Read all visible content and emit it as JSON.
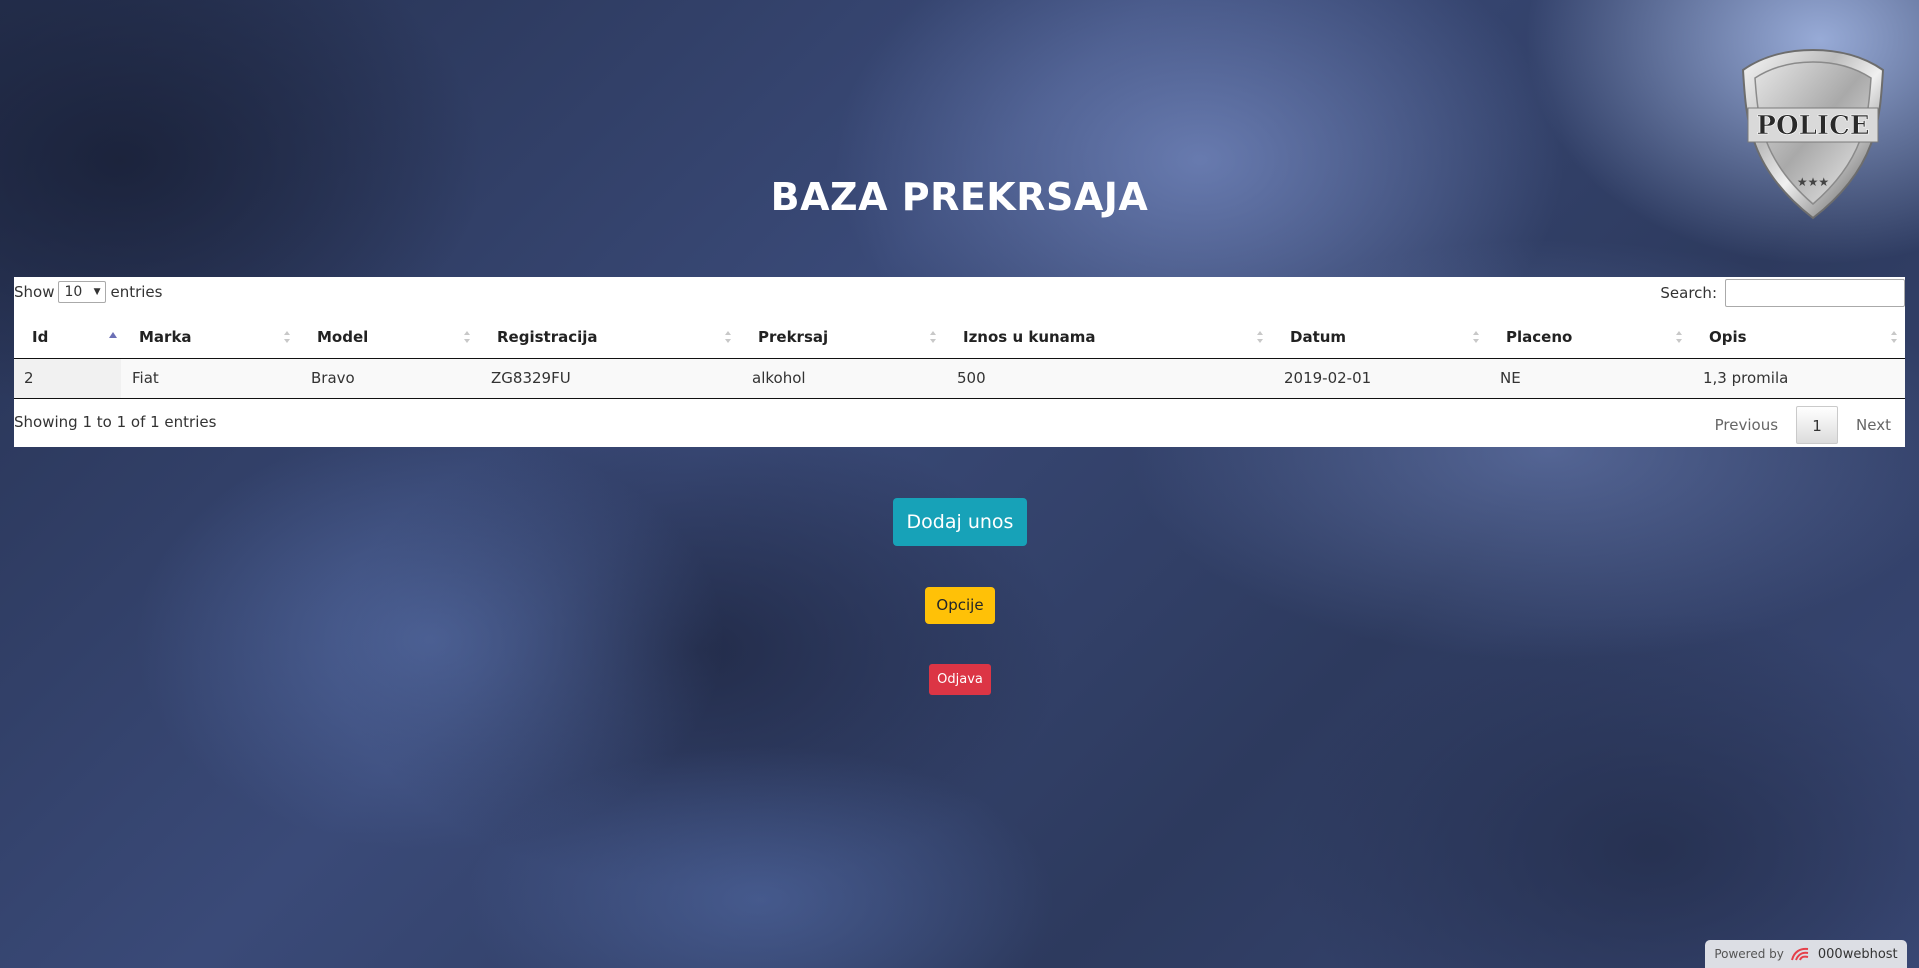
{
  "badge": {
    "text": "POLICE"
  },
  "page": {
    "title": "BAZA PREKRSAJA"
  },
  "table": {
    "length_prefix": "Show",
    "length_value": "10",
    "length_suffix": "entries",
    "search_label": "Search:",
    "search_value": "",
    "columns": [
      "Id",
      "Marka",
      "Model",
      "Registracija",
      "Prekrsaj",
      "Iznos u kunama",
      "Datum",
      "Placeno",
      "Opis"
    ],
    "sorted_column": "Id",
    "sort_direction": "ascending",
    "rows": [
      [
        "2",
        "Fiat",
        "Bravo",
        "ZG8329FU",
        "alkohol",
        "500",
        "2019-02-01",
        "NE",
        "1,3 promila"
      ]
    ],
    "info": "Showing 1 to 1 of 1 entries",
    "pagination": {
      "previous": "Previous",
      "current": "1",
      "next": "Next"
    }
  },
  "actions": {
    "add_label": "Dodaj unos",
    "options_label": "Opcije",
    "logout_label": "Odjava"
  },
  "footer": {
    "powered_by": "Powered by",
    "brand": "000webhost",
    "icon": "000webhost-logo-icon"
  },
  "colors": {
    "add_button": "#17a2b8",
    "options_button": "#ffc107",
    "logout_button": "#dc3545"
  }
}
